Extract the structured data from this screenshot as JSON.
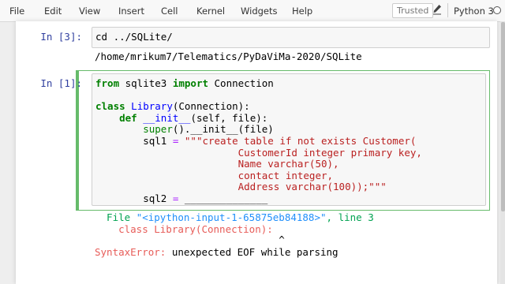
{
  "menu": {
    "items": [
      "File",
      "Edit",
      "View",
      "Insert",
      "Cell",
      "Kernel",
      "Widgets",
      "Help"
    ],
    "trusted_label": "Trusted",
    "kernel_name": "Python 3"
  },
  "cell1": {
    "prompt": "In [3]:",
    "input": "cd ../SQLite/",
    "output": "/home/mrikum7/Telematics/PyDaViMa-2020/SQLite"
  },
  "cell2": {
    "prompt": "In [1]:",
    "tb_file_label": "  File ",
    "tb_filename": "\"<ipython-input-1-65875eb84188>\"",
    "tb_line_label": ", line 3",
    "tb_code": "    class Library(Connection):",
    "tb_caret": "                               ^",
    "error_type": "SyntaxError:",
    "error_message": " unexpected EOF while parsing"
  },
  "colors": {
    "keyword": "#008000",
    "class_name": "#0000ff",
    "string": "#ba2121",
    "operator": "#aa22ff",
    "prompt": "#303f9f",
    "selected_cell_border": "#66bb6a",
    "error": "#e75c58"
  },
  "icons": {
    "edit_mode": "pencil-icon",
    "kernel_status": "kernel-idle-circle-icon"
  }
}
